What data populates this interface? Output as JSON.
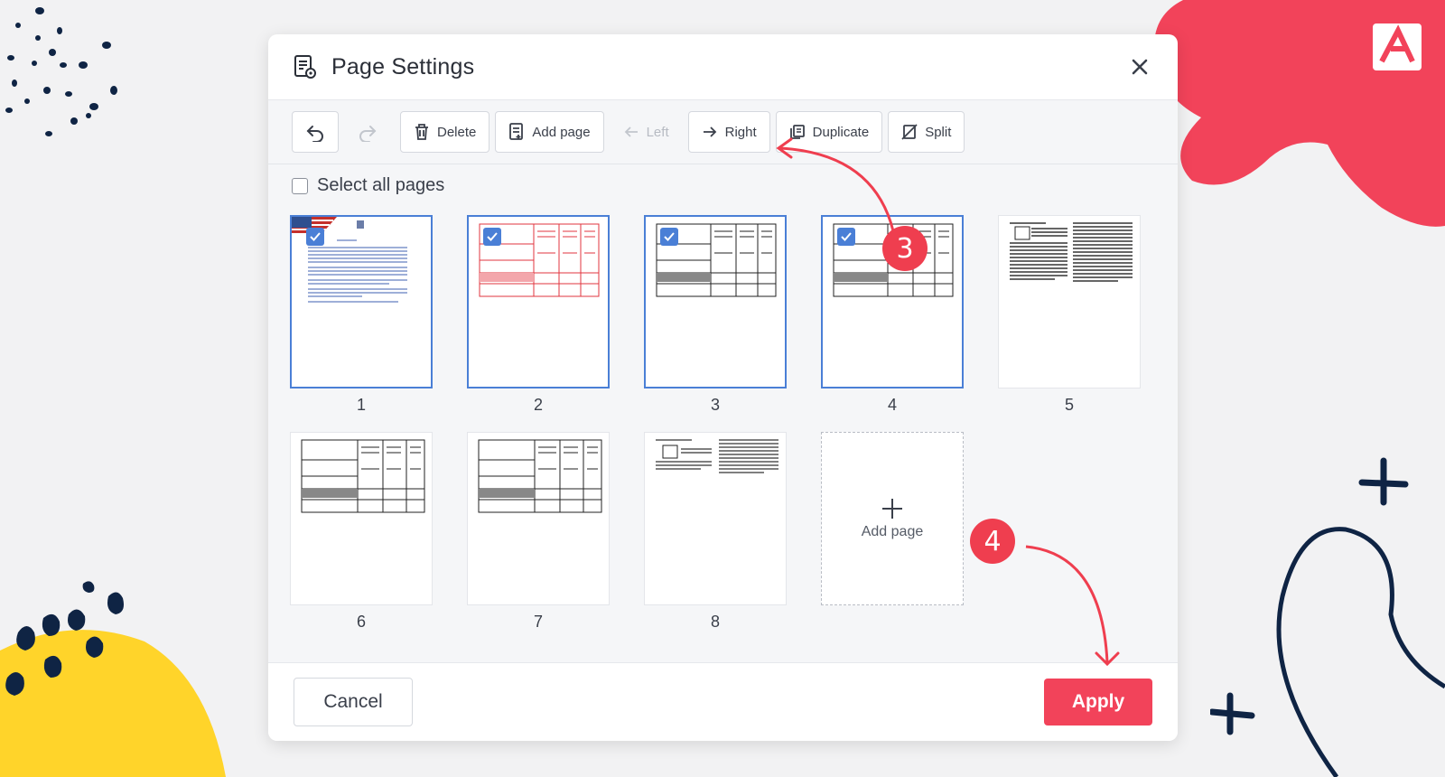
{
  "modal": {
    "title": "Page Settings"
  },
  "toolbar": {
    "delete_label": "Delete",
    "add_page_label": "Add page",
    "left_label": "Left",
    "right_label": "Right",
    "duplicate_label": "Duplicate",
    "split_label": "Split"
  },
  "select_all": {
    "label": "Select all pages"
  },
  "pages": {
    "p1": "1",
    "p2": "2",
    "p3": "3",
    "p4": "4",
    "p5": "5",
    "p6": "6",
    "p7": "7",
    "p8": "8"
  },
  "add_page_tile": {
    "label": "Add page"
  },
  "footer": {
    "cancel_label": "Cancel",
    "apply_label": "Apply"
  },
  "steps": {
    "step_3": "3",
    "step_4": "4"
  },
  "colors": {
    "accent": "#f2435a",
    "selection": "#4a7fd6",
    "navy": "#0f2444",
    "yellow": "#ffd42a"
  }
}
